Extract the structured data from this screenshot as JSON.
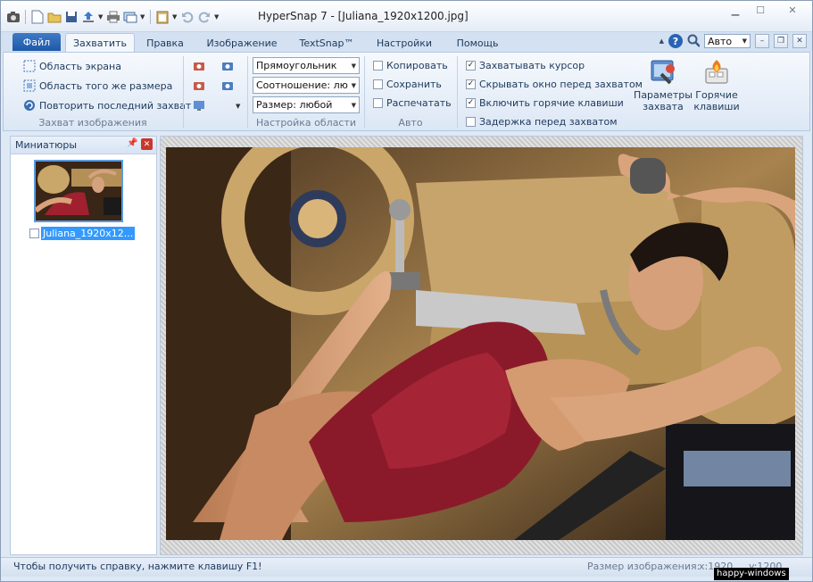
{
  "window": {
    "title": "HyperSnap 7 - [Juliana_1920x1200.jpg]"
  },
  "quick_access": {
    "icons": [
      "app-camera-icon",
      "new-document-icon",
      "open-folder-icon",
      "save-icon",
      "upload-icon",
      "print-icon",
      "copy-screen-icon",
      "clipboard-icon",
      "undo-icon",
      "redo-icon",
      "customize-icon"
    ]
  },
  "ribbon": {
    "file_tab": "Файл",
    "tabs": [
      "Захватить",
      "Правка",
      "Изображение",
      "TextSnap™",
      "Настройки",
      "Помощь"
    ],
    "active_tab": "Захватить",
    "zoom_value": "Авто",
    "capture_group": {
      "items": [
        "Область экрана",
        "Область того же размера",
        "Повторить последний захват"
      ],
      "label": "Захват изображения"
    },
    "region_group": {
      "shape": "Прямоугольник",
      "ratio": "Соотношение: лю",
      "size": "Размер: любой",
      "label": "Настройка области"
    },
    "auto_group": {
      "items": [
        {
          "label": "Копировать",
          "checked": false
        },
        {
          "label": "Сохранить",
          "checked": false
        },
        {
          "label": "Распечатать",
          "checked": false
        }
      ],
      "label": "Авто"
    },
    "options_group": {
      "items": [
        {
          "label": "Захватывать курсор",
          "checked": true
        },
        {
          "label": "Скрывать окно перед захватом",
          "checked": true
        },
        {
          "label": "Включить горячие клавиши",
          "checked": true
        },
        {
          "label": "Задержка перед захватом",
          "checked": false
        }
      ]
    },
    "capture_params": {
      "line1": "Параметры",
      "line2": "захвата"
    },
    "hotkeys": {
      "line1": "Горячие",
      "line2": "клавиши"
    }
  },
  "thumbnails": {
    "title": "Миниатюры",
    "item_label": "Juliana_1920x12..."
  },
  "status": {
    "help": "Чтобы получить справку, нажмите клавишу F1!",
    "size_label": "Размер изображения:",
    "x": "x:1920",
    "y": "y:1200"
  },
  "watermark": "happy-windows",
  "colors": {
    "accent": "#1e59a8",
    "selection": "#3399ff",
    "close_red": "#c7382d"
  }
}
